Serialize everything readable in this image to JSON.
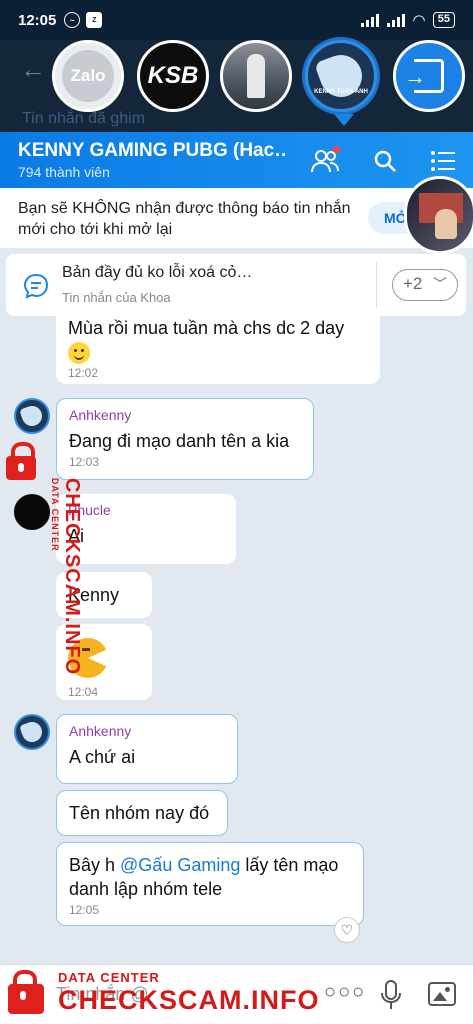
{
  "status_bar": {
    "time": "12:05",
    "battery": "55"
  },
  "bubble_bar": {
    "pinned_ghost": "Tin nhắn đã ghim"
  },
  "chat_heads": [
    {
      "label": "Zalo"
    },
    {
      "label": "KSB"
    },
    {
      "label": ""
    },
    {
      "label": "KENNY TUẤN ANH"
    }
  ],
  "header": {
    "title": "KENNY GAMING PUBG (Hac…",
    "members": "794 thành viên"
  },
  "notice": {
    "text": "Bạn sẽ KHÔNG nhận được thông báo tin nhắn mới cho tới khi mở lại",
    "button": "MỞ"
  },
  "pinned": {
    "title": "Bản đầy đủ ko lỗi xoá cỏ…",
    "subtitle": "Tin nhắn của Khoa",
    "more": "+2"
  },
  "messages": {
    "m1": {
      "text": "Mùa rồi mua tuần mà chs dc 2 day",
      "time": "12:02"
    },
    "m2": {
      "sender": "Anhkenny",
      "text": "Đang đi mạo danh tên a kia",
      "time": "12:03"
    },
    "m3": {
      "sender": "Phucle",
      "text": "Ai"
    },
    "m4": {
      "text": "Kenny"
    },
    "m5": {
      "time": "12:04"
    },
    "m6": {
      "sender": "Anhkenny",
      "text": "A chứ ai"
    },
    "m7": {
      "text": "Tên nhóm nay đó"
    },
    "m8": {
      "prefix": "Bây h ",
      "mention": "@Gấu Gaming",
      "suffix": " lấy tên mạo danh lập nhóm tele",
      "time": "12:05"
    }
  },
  "input": {
    "placeholder": "Tin nhắn @"
  },
  "watermark": {
    "line1": "DATA CENTER",
    "line2": "CHECKSCAM.INFO"
  },
  "icons": [
    "back-arrow-icon",
    "exit-icon",
    "add-member-icon",
    "search-icon",
    "list-menu-icon",
    "pinned-message-icon",
    "chevron-down-icon",
    "heart-icon",
    "more-icon",
    "mic-icon",
    "image-icon",
    "lock-icon"
  ],
  "colors": {
    "header": "#0a7be5",
    "mention": "#1a7ad8",
    "sender_name": "#8e3ea8",
    "watermark": "#d21b17",
    "chat_bg": "#e2e8f0"
  }
}
